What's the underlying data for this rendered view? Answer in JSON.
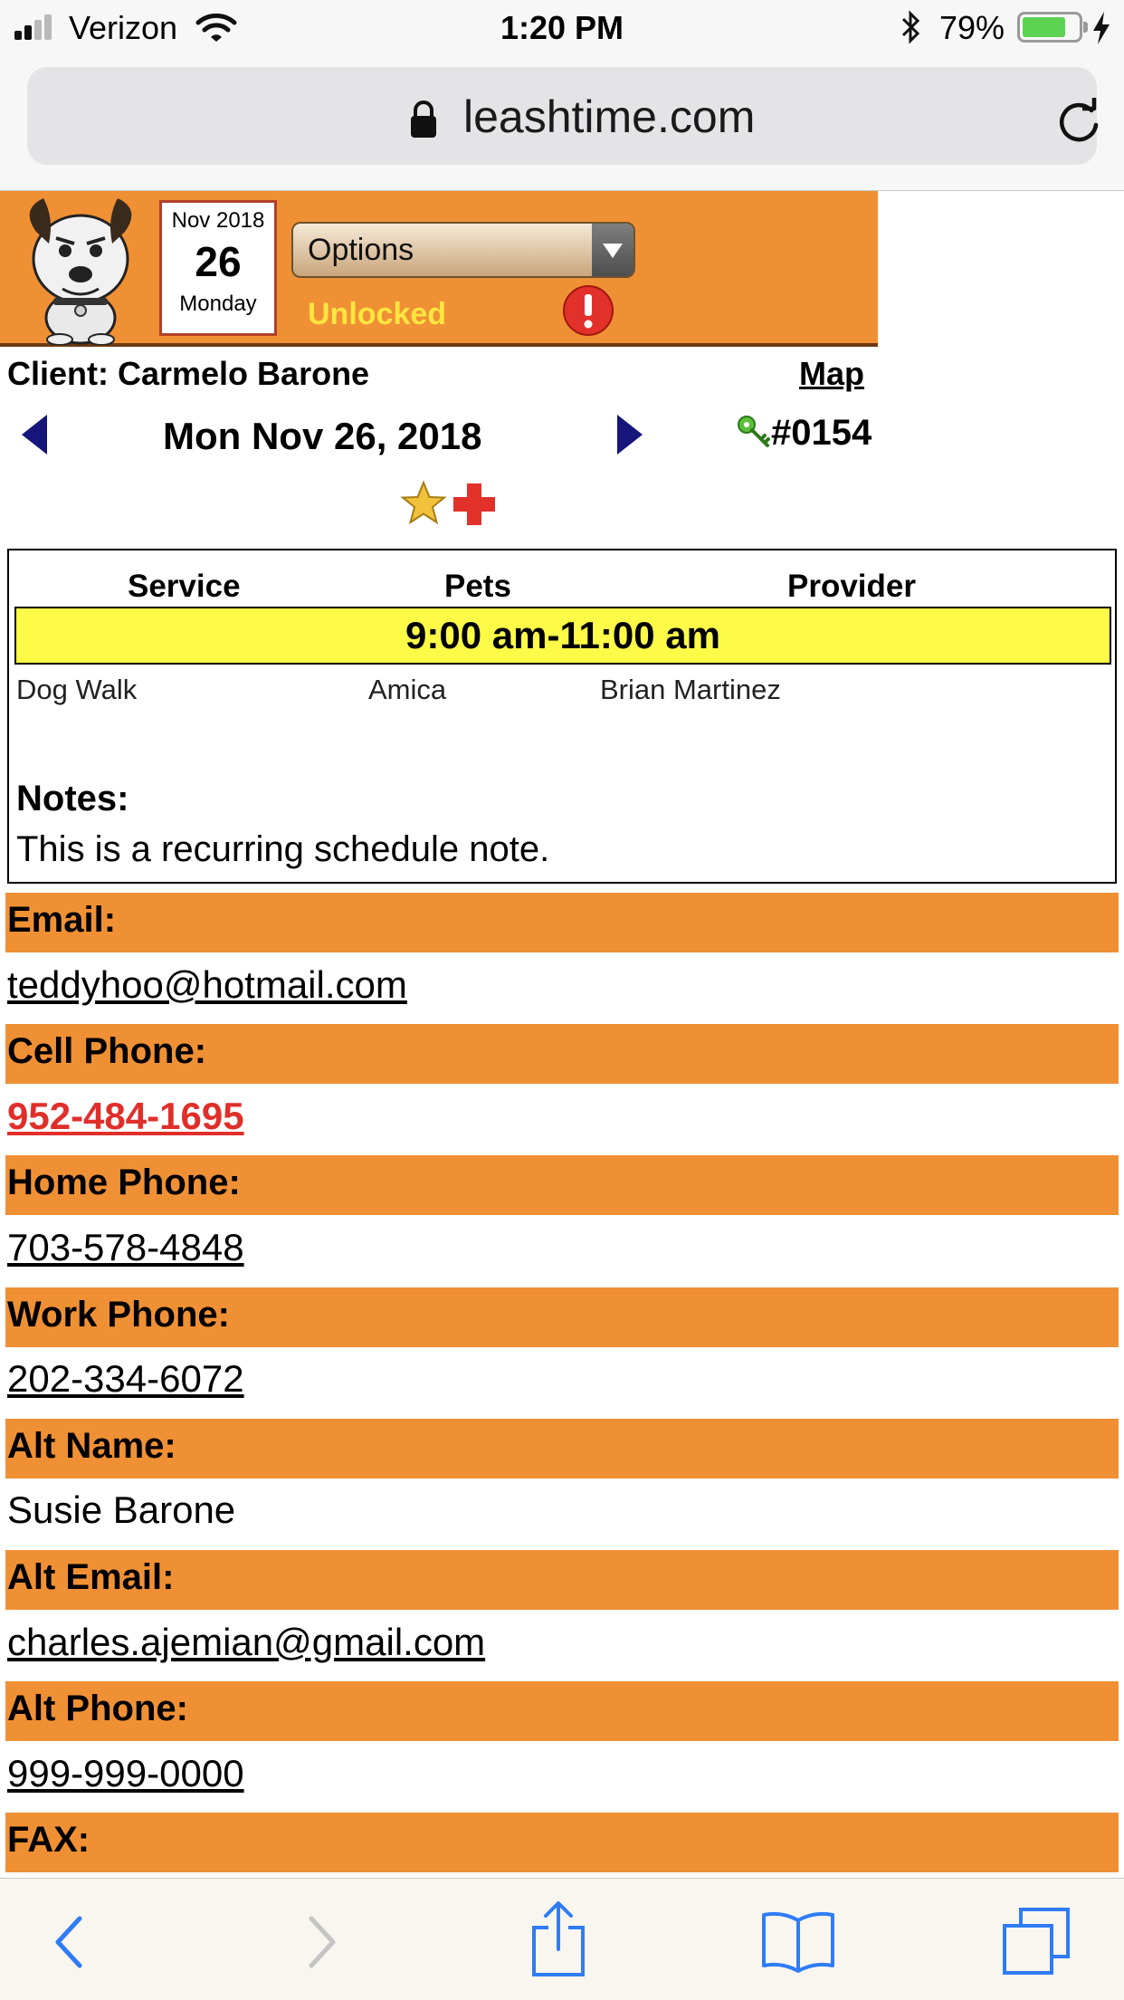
{
  "status_bar": {
    "carrier": "Verizon",
    "time": "1:20 PM",
    "battery_percent": "79%",
    "battery_level": 0.79,
    "signal_bars": 2
  },
  "browser": {
    "url": "leashtime.com"
  },
  "header": {
    "date": {
      "month_year": "Nov 2018",
      "day": "26",
      "weekday": "Monday"
    },
    "options_label": "Options",
    "lock_status": "Unlocked",
    "colors": {
      "header_bg": "#f09035",
      "unlocked_text": "#ffe640",
      "alert": "#e2302a"
    }
  },
  "client": {
    "label": "Client: Carmelo Barone",
    "map_label": "Map",
    "visit_date": "Mon Nov 26, 2018",
    "key_number": "#0154"
  },
  "visit": {
    "columns": [
      "Service",
      "Pets",
      "Provider"
    ],
    "time_window": "9:00 am-11:00 am",
    "row": {
      "service": "Dog Walk",
      "pets": "Amica",
      "provider": "Brian Martinez"
    },
    "notes_label": "Notes:",
    "notes_text": "This is a recurring schedule note."
  },
  "fields": [
    {
      "label": "Email:",
      "value": "teddyhoo@hotmail.com",
      "style": "link"
    },
    {
      "label": "Cell Phone:",
      "value": "952-484-1695",
      "style": "link-red"
    },
    {
      "label": "Home Phone:",
      "value": "703-578-4848",
      "style": "link"
    },
    {
      "label": "Work Phone:",
      "value": "202-334-6072",
      "style": "link"
    },
    {
      "label": "Alt Name:",
      "value": "Susie Barone",
      "style": "plain"
    },
    {
      "label": "Alt Email:",
      "value": "charles.ajemian@gmail.com",
      "style": "link"
    },
    {
      "label": "Alt Phone:",
      "value": "999-999-0000",
      "style": "link"
    },
    {
      "label": "FAX:",
      "value": "",
      "style": "plain"
    }
  ],
  "toolbar": {
    "icons": [
      "back-icon",
      "forward-icon",
      "share-icon",
      "bookmarks-icon",
      "tabs-icon"
    ]
  }
}
